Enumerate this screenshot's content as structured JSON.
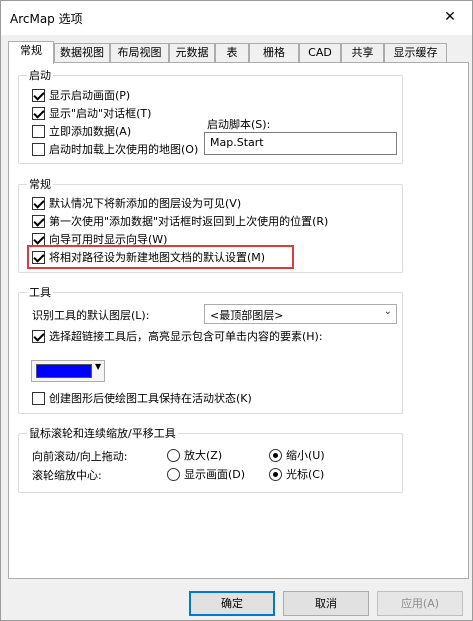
{
  "window": {
    "title": "ArcMap 选项",
    "close_glyph": "✕"
  },
  "tabs": [
    "常规",
    "数据视图",
    "布局视图",
    "元数据",
    "表",
    "栅格",
    "CAD",
    "共享",
    "显示缓存"
  ],
  "startup": {
    "label": "启动",
    "show_splash": "显示启动画面(P)",
    "show_startup_dialog": "显示\"启动\"对话框(T)",
    "add_data_now": "立即添加数据(A)",
    "load_last_map": "启动时加载上次使用的地图(O)",
    "script_label": "启动脚本(S):",
    "script_value": "Map.Start"
  },
  "general": {
    "label": "常规",
    "make_visible": "默认情况下将新添加的图层设为可见(V)",
    "return_location": "第一次使用\"添加数据\"对话框时返回到上次使用的位置(R)",
    "wizards": "向导可用时显示向导(W)",
    "relative_paths": "将相对路径设为新建地图文档的默认设置(M)"
  },
  "tools": {
    "label": "工具",
    "identify_label": "识别工具的默认图层(L):",
    "identify_value": "<最顶部图层>",
    "hyperlink": "选择超链接工具后，高亮显示包含可单击内容的要素(H):",
    "highlight_color": "#0000ff",
    "keep_active": "创建图形后使绘图工具保持在活动状态(K)"
  },
  "mouse": {
    "label": "鼠标滚轮和连续缩放/平移工具",
    "forward_label": "向前滚动/向上拖动:",
    "zoom_in": "放大(Z)",
    "zoom_out": "缩小(U)",
    "center_label": "滚轮缩放中心:",
    "center_display": "显示画面(D)",
    "center_cursor": "光标(C)"
  },
  "buttons": {
    "ok": "确定",
    "cancel": "取消",
    "apply": "应用(A)"
  }
}
